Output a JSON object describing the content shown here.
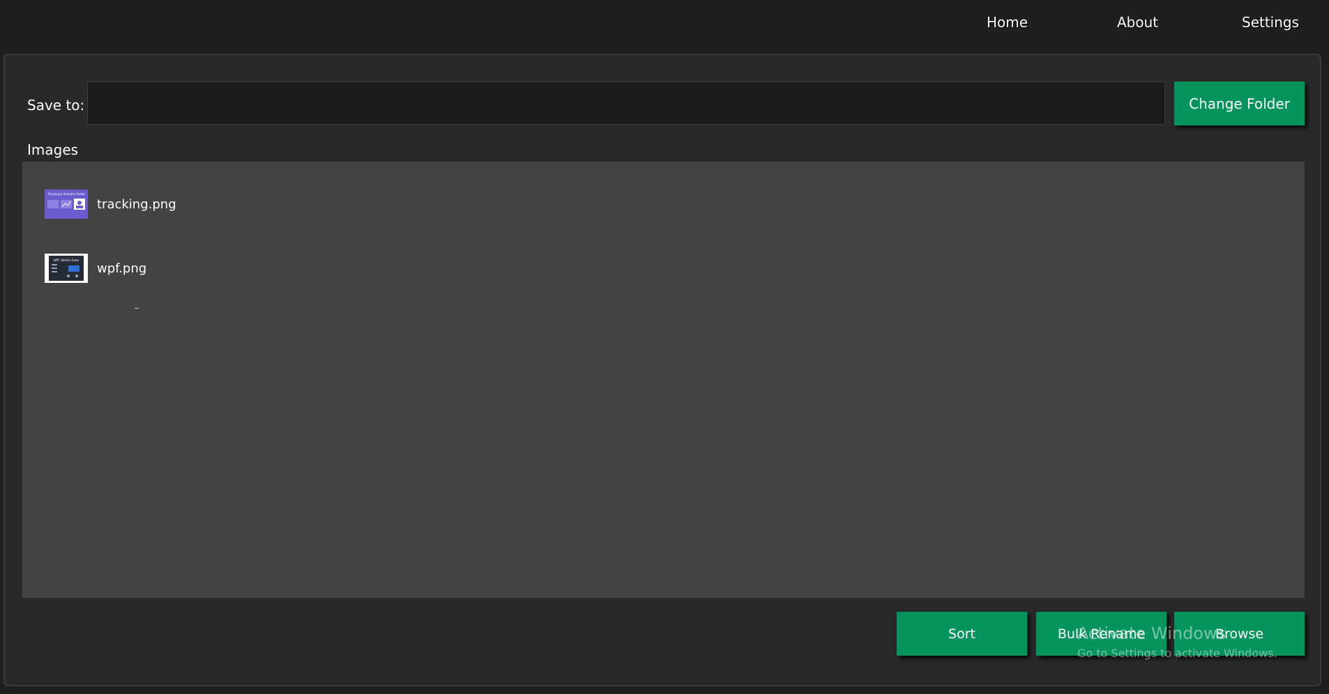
{
  "nav": {
    "home": "Home",
    "about": "About",
    "settings": "Settings"
  },
  "save": {
    "label": "Save to:",
    "value": "",
    "change_folder": "Change Folder"
  },
  "images": {
    "label": "Images",
    "items": [
      {
        "name": "tracking.png",
        "thumb_title": "Tracking & Analytics Portal"
      },
      {
        "name": "wpf.png",
        "thumb_title": "WPF Utilities Suite"
      }
    ]
  },
  "actions": {
    "sort": "Sort",
    "bulk_rename": "Bulk Rename",
    "browse": "Browse"
  },
  "watermark": {
    "title": "Activate Windows",
    "subtitle": "Go to Settings to activate Windows."
  },
  "colors": {
    "accent": "#05945e",
    "background": "#1f1f1f",
    "panel": "#292929",
    "list": "#434343",
    "input": "#1a1a1a"
  }
}
